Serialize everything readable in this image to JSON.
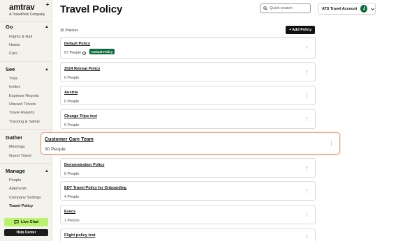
{
  "brand": {
    "name": "amtrav",
    "plus": "+",
    "tagline": "A TravelPerk Company"
  },
  "sidebar": {
    "sections": [
      {
        "title": "Go",
        "items": [
          "Flights & Rail",
          "Hotels",
          "Cars"
        ]
      },
      {
        "title": "See",
        "items": [
          "Trips",
          "Invites",
          "Expense Reports",
          "Unused Tickets",
          "Travel Reports",
          "Tracking & Safety"
        ]
      },
      {
        "title": "Gather",
        "items": [
          "Meetings",
          "Guest Travel"
        ]
      },
      {
        "title": "Manage",
        "items": [
          "People",
          "Approvals",
          "Company Settings",
          "Travel Policy"
        ]
      }
    ],
    "active_item": "Travel Policy",
    "live_chat_label": "Live Chat",
    "help_center_label": "Help Center"
  },
  "header": {
    "title": "Travel Policy",
    "search_placeholder": "Quick search",
    "account_name": "ATS Travel Account",
    "avatar_initial": "J"
  },
  "main": {
    "policy_count": "26 Policies",
    "add_button_label": "+ Add Policy",
    "policies": [
      {
        "name": "Default Policy",
        "people": "57 People",
        "badge": "Default Policy"
      },
      {
        "name": "2024 Retreat Policy",
        "people": "0 People"
      },
      {
        "name": "Austria",
        "people": "0 People"
      },
      {
        "name": "Change Trips test",
        "people": "0 People"
      },
      {
        "name": "Customer Care Team",
        "people": "30 People",
        "highlighted": true
      },
      {
        "name": "Demonstration Policy",
        "people": "0 People"
      },
      {
        "name": "EDT Travel Policy for Onboarding",
        "people": "4 People"
      },
      {
        "name": "Execs",
        "people": "1 Person"
      },
      {
        "name": "Flight policy test",
        "people": ""
      }
    ]
  },
  "icons": {
    "chevron_up": "chevron-up-icon",
    "chevron_down": "chevron-down-icon",
    "search": "search-icon",
    "kebab": "kebab-menu-icon",
    "chat": "chat-icon",
    "info": "info-icon"
  },
  "colors": {
    "accent_green": "#0e6b3c",
    "live_chat": "#b9f26b",
    "highlight_border": "#e0a080",
    "sidebar_bg": "#f3f2ec"
  }
}
